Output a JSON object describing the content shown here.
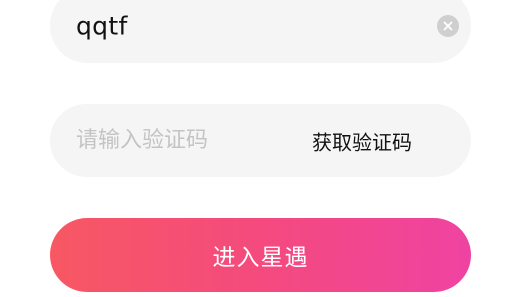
{
  "login_form": {
    "username": {
      "value": "qqtf",
      "clear_icon": "close-circle-icon"
    },
    "verification_code": {
      "placeholder": "请输入验证码",
      "value": "",
      "get_code_label": "获取验证码"
    },
    "submit_label": "进入星遇"
  },
  "colors": {
    "field_background": "#f5f5f5",
    "placeholder_text": "#c4c4c4",
    "gradient_start": "#f75863",
    "gradient_end": "#ef43a2",
    "clear_icon": "#cfcfcf"
  }
}
